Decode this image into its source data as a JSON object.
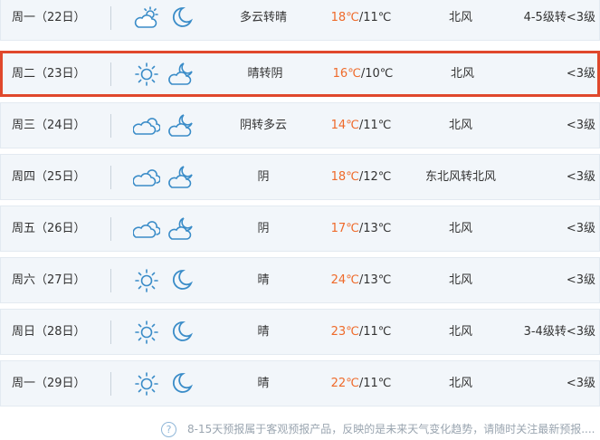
{
  "colors": {
    "temp_high": "#ef6a2a",
    "icon_stroke": "#3a8cc8",
    "selected_border": "#e0482c"
  },
  "forecast": [
    {
      "day": "周一（22日）",
      "icon_day": "partly-cloudy-sun-icon",
      "icon_night": "moon-icon",
      "condition": "多云转晴",
      "temp_high": "18℃",
      "temp_low": "/11℃",
      "wind": "北风",
      "level": "4-5级转<3级"
    },
    {
      "day": "周二（23日）",
      "icon_day": "sun-icon",
      "icon_night": "cloud-moon-icon",
      "condition": "晴转阴",
      "temp_high": "16℃",
      "temp_low": "/10℃",
      "wind": "北风",
      "level": "<3级"
    },
    {
      "day": "周三（24日）",
      "icon_day": "cloud-icon",
      "icon_night": "cloud-moon-icon",
      "condition": "阴转多云",
      "temp_high": "14℃",
      "temp_low": "/11℃",
      "wind": "北风",
      "level": "<3级"
    },
    {
      "day": "周四（25日）",
      "icon_day": "cloud-icon",
      "icon_night": "cloud-moon-icon",
      "condition": "阴",
      "temp_high": "18℃",
      "temp_low": "/12℃",
      "wind": "东北风转北风",
      "level": "<3级"
    },
    {
      "day": "周五（26日）",
      "icon_day": "cloud-icon",
      "icon_night": "cloud-moon-icon",
      "condition": "阴",
      "temp_high": "17℃",
      "temp_low": "/13℃",
      "wind": "北风",
      "level": "<3级"
    },
    {
      "day": "周六（27日）",
      "icon_day": "sun-icon",
      "icon_night": "moon-icon",
      "condition": "晴",
      "temp_high": "24℃",
      "temp_low": "/13℃",
      "wind": "北风",
      "level": "<3级"
    },
    {
      "day": "周日（28日）",
      "icon_day": "sun-icon",
      "icon_night": "moon-icon",
      "condition": "晴",
      "temp_high": "23℃",
      "temp_low": "/11℃",
      "wind": "北风",
      "level": "3-4级转<3级"
    },
    {
      "day": "周一（29日）",
      "icon_day": "sun-icon",
      "icon_night": "moon-icon",
      "condition": "晴",
      "temp_high": "22℃",
      "temp_low": "/11℃",
      "wind": "北风",
      "level": "<3级"
    }
  ],
  "footer": {
    "help_icon": "?",
    "note": "8-15天预报属于客观预报产品，反映的是未来天气变化趋势，请随时关注最新预报...."
  }
}
